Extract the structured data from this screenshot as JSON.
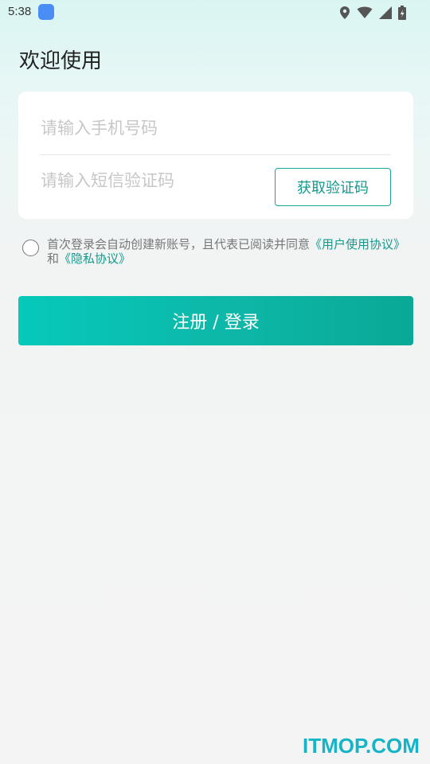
{
  "status_bar": {
    "time": "5:38",
    "app_icon_color": "#4a8ef5",
    "icons": [
      "location-icon",
      "wifi-icon",
      "signal-icon",
      "battery-icon"
    ]
  },
  "welcome_title": "欢迎使用",
  "form": {
    "phone_placeholder": "请输入手机号码",
    "phone_value": "",
    "code_placeholder": "请输入短信验证码",
    "code_value": "",
    "get_code_label": "获取验证码"
  },
  "agreement": {
    "checked": false,
    "text_prefix": "首次登录会自动创建新账号，且代表已阅读并同意",
    "user_agreement_link": "《用户使用协议》",
    "conjunction": "和",
    "privacy_link": "《隐私协议》"
  },
  "login_button_label": "注册 / 登录",
  "watermark": "ITMOP.COM",
  "colors": {
    "accent": "#13998c",
    "button_gradient_start": "#06c9bb",
    "button_gradient_end": "#0aa896"
  }
}
